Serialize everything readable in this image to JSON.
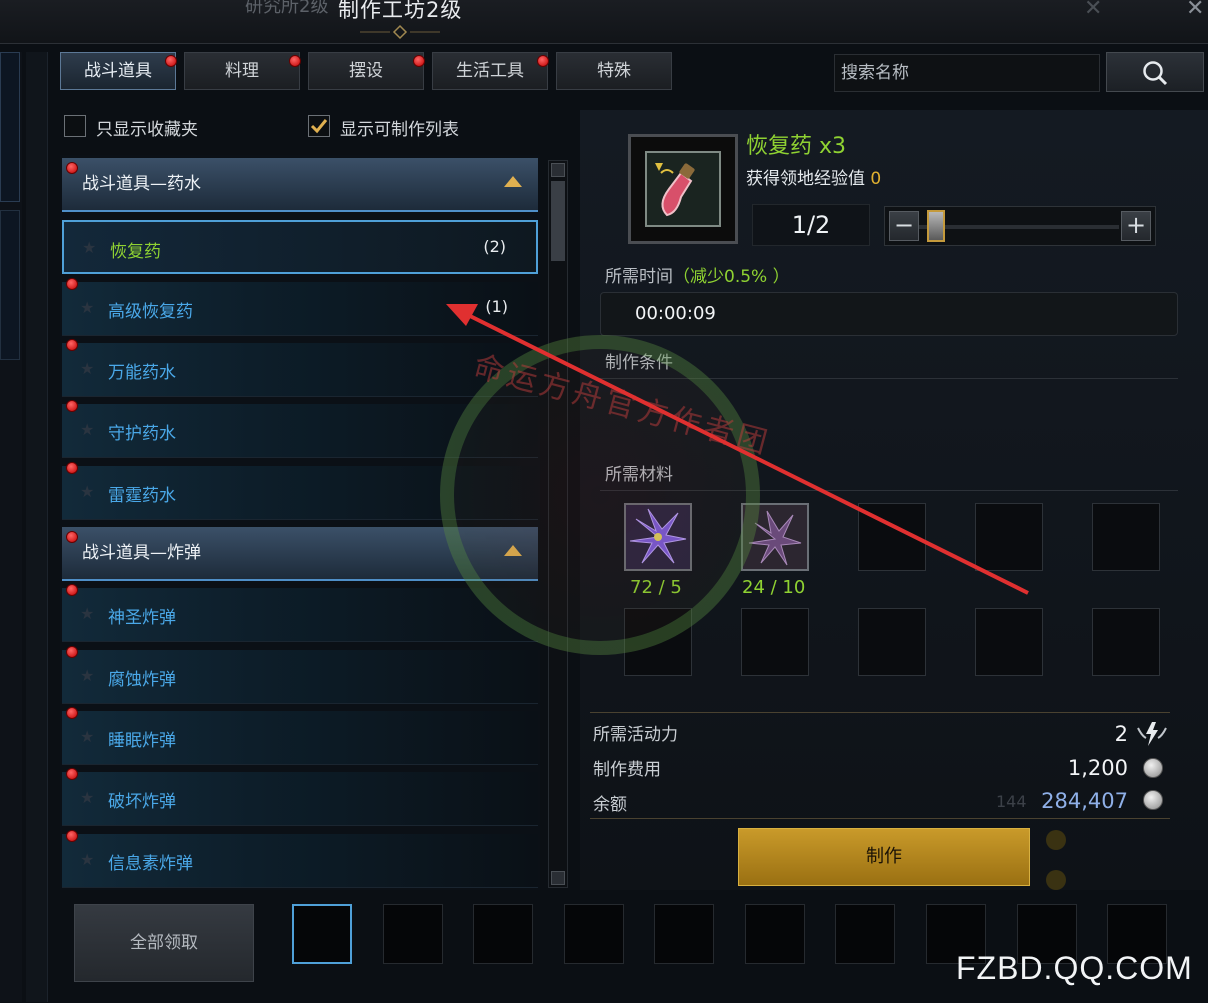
{
  "window": {
    "title": "制作工坊2级",
    "title_behind": "研究所2级"
  },
  "tabs": [
    {
      "label": "战斗道具",
      "active": true,
      "badge": true
    },
    {
      "label": "料理",
      "active": false,
      "badge": true
    },
    {
      "label": "摆设",
      "active": false,
      "badge": true
    },
    {
      "label": "生活工具",
      "active": false,
      "badge": true
    },
    {
      "label": "特殊",
      "active": false,
      "badge": false
    }
  ],
  "search": {
    "placeholder": "搜索名称"
  },
  "filters": {
    "favorites_only": {
      "label": "只显示收藏夹",
      "checked": false
    },
    "craftable_only": {
      "label": "显示可制作列表",
      "checked": true
    }
  },
  "categories": [
    {
      "label": "战斗道具—药水",
      "items": [
        {
          "name": "恢复药",
          "count": "(2)",
          "selected": true,
          "badge": false
        },
        {
          "name": "高级恢复药",
          "count": "(1)",
          "selected": false,
          "badge": true
        },
        {
          "name": "万能药水",
          "count": "",
          "selected": false,
          "badge": true
        },
        {
          "name": "守护药水",
          "count": "",
          "selected": false,
          "badge": true
        },
        {
          "name": "雷霆药水",
          "count": "",
          "selected": false,
          "badge": true
        }
      ]
    },
    {
      "label": "战斗道具—炸弹",
      "items": [
        {
          "name": "神圣炸弹",
          "count": "",
          "selected": false,
          "badge": true
        },
        {
          "name": "腐蚀炸弹",
          "count": "",
          "selected": false,
          "badge": true
        },
        {
          "name": "睡眠炸弹",
          "count": "",
          "selected": false,
          "badge": true
        },
        {
          "name": "破坏炸弹",
          "count": "",
          "selected": false,
          "badge": true
        },
        {
          "name": "信息素炸弹",
          "count": "",
          "selected": false,
          "badge": true
        }
      ]
    }
  ],
  "detail": {
    "item_name": "恢复药 x3",
    "exp_label": "获得领地经验值",
    "exp_value": "0",
    "quantity": "1/2",
    "slider_fraction": 0.05,
    "time_label": "所需时间",
    "time_reduction": "（减少0.5% ）",
    "time_value": "00:00:09",
    "conditions_label": "制作条件",
    "materials_label": "所需材料",
    "materials": [
      {
        "icon": "purple-lily-icon",
        "qty": "72 / 5"
      },
      {
        "icon": "dark-lily-icon",
        "qty": "24 / 10"
      }
    ],
    "energy_label": "所需活动力",
    "energy_value": "2",
    "cost_label": "制作费用",
    "cost_value": "1,200",
    "balance_label": "余额",
    "balance_ghost": "144",
    "balance_value": "284,407",
    "craft_button": "制作"
  },
  "bottom": {
    "claim_all": "全部领取"
  },
  "watermark": {
    "site": "FZBD.QQ.COM",
    "stamp": "命运方舟官方作者团"
  },
  "colors": {
    "accent_green": "#8fd232",
    "link_blue": "#4aa8e8",
    "badge_red": "#d00000",
    "gold": "#c99a2a",
    "annotation_arrow": "#e03030"
  }
}
